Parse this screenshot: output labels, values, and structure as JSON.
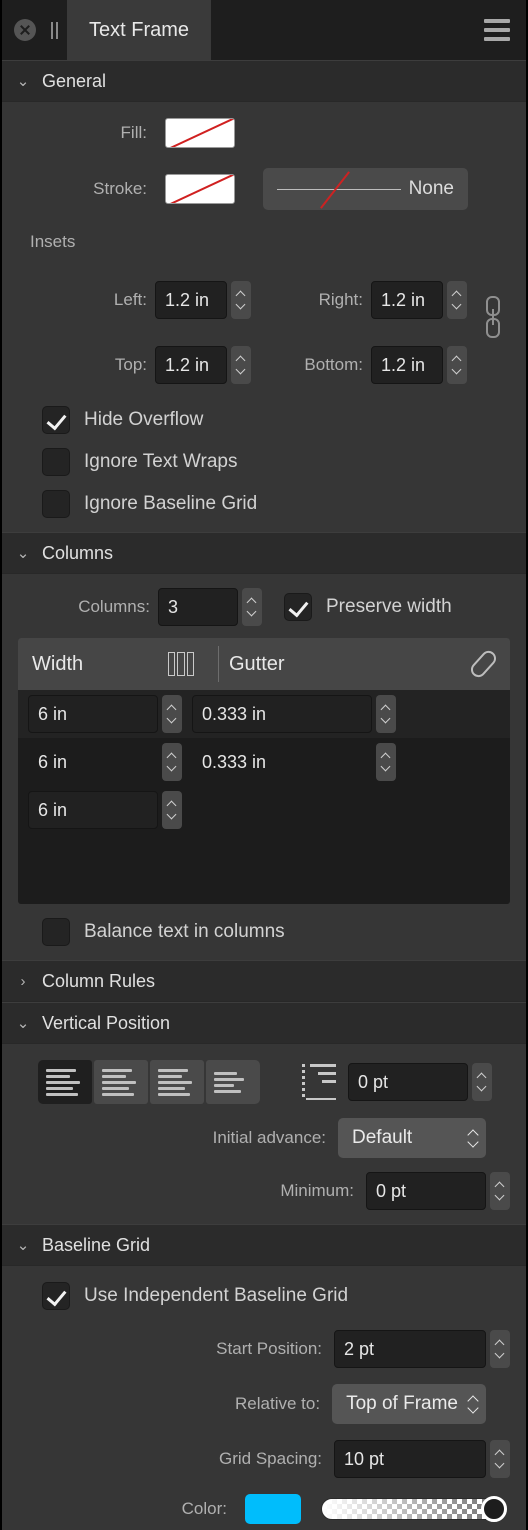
{
  "titlebar": {
    "close_icon": "close-circle-icon",
    "drag_icon": "pause-handle-icon",
    "tab_label": "Text Frame",
    "menu_icon": "hamburger-menu-icon"
  },
  "sections": {
    "general": {
      "title": "General",
      "expanded": true,
      "caret": "⌄",
      "fill_label": "Fill:",
      "fill_value": "None",
      "stroke_label": "Stroke:",
      "stroke_value": "None",
      "stroke_style_label": "None",
      "insets_label": "Insets",
      "insets": [
        {
          "label": "Left:",
          "value": "1.2 in"
        },
        {
          "label": "Right:",
          "value": "1.2 in"
        },
        {
          "label": "Top:",
          "value": "1.2 in"
        },
        {
          "label": "Bottom:",
          "value": "1.2 in"
        }
      ],
      "link_icon": "chain-link-icon",
      "checkboxes": [
        {
          "label": "Hide Overflow",
          "checked": true
        },
        {
          "label": "Ignore Text Wraps",
          "checked": false
        },
        {
          "label": "Ignore Baseline Grid",
          "checked": false
        }
      ]
    },
    "columns": {
      "title": "Columns",
      "expanded": true,
      "caret": "⌄",
      "columns_label": "Columns:",
      "columns_value": "3",
      "preserve_width_label": "Preserve width",
      "preserve_width_checked": true,
      "table": {
        "header_width": "Width",
        "header_gutter": "Gutter",
        "columns_icon": "three-columns-icon",
        "edit_icon": "pencil-icon",
        "rows": [
          {
            "width": "6 in",
            "gutter": "0.333 in"
          },
          {
            "width": "6 in",
            "gutter": "0.333 in"
          },
          {
            "width": "6 in",
            "gutter": ""
          }
        ]
      },
      "balance_label": "Balance text in columns",
      "balance_checked": false
    },
    "column_rules": {
      "title": "Column Rules",
      "expanded": false,
      "caret": "›"
    },
    "vertical_position": {
      "title": "Vertical Position",
      "expanded": true,
      "caret": "⌄",
      "align_buttons": [
        {
          "name": "align-top-icon",
          "selected": true
        },
        {
          "name": "align-center-icon",
          "selected": false
        },
        {
          "name": "align-bottom-icon",
          "selected": false
        },
        {
          "name": "align-justify-icon",
          "selected": false
        }
      ],
      "first_baseline_icon": "first-baseline-offset-icon",
      "first_baseline_value": "0 pt",
      "initial_advance_label": "Initial advance:",
      "initial_advance_value": "Default",
      "minimum_label": "Minimum:",
      "minimum_value": "0 pt"
    },
    "baseline_grid": {
      "title": "Baseline Grid",
      "expanded": true,
      "caret": "⌄",
      "use_independent_label": "Use Independent Baseline Grid",
      "use_independent_checked": true,
      "start_position_label": "Start Position:",
      "start_position_value": "2 pt",
      "relative_to_label": "Relative to:",
      "relative_to_value": "Top of Frame",
      "grid_spacing_label": "Grid Spacing:",
      "grid_spacing_value": "10 pt",
      "color_label": "Color:",
      "color_value": "#00bdfc",
      "opacity_percent": "100"
    }
  }
}
